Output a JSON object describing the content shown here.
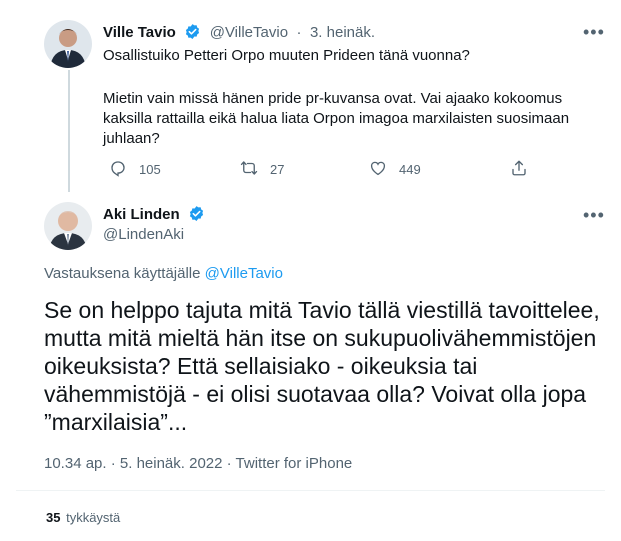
{
  "tweet1": {
    "author_name": "Ville Tavio",
    "handle": "@VilleTavio",
    "separator": "·",
    "date": "3. heinäk.",
    "text_p1": "Osallistuiko Petteri Orpo muuten Prideen tänä vuonna?",
    "text_p2": "Mietin vain missä hänen pride pr-kuvansa ovat. Vai ajaako kokoomus kaksilla rattailla eikä halua liata Orpon imagoa marxilaisten suosimaan juhlaan?",
    "replies": "105",
    "retweets": "27",
    "likes": "449"
  },
  "tweet2": {
    "author_name": "Aki Linden",
    "handle": "@LindenAki",
    "reply_prefix": "Vastauksena käyttäjälle",
    "reply_handle": "@VilleTavio",
    "text": "Se on helppo tajuta mitä Tavio tällä viestillä tavoittelee, mutta mitä mieltä hän itse on sukupuolivähemmistöjen oikeuksista? Että sellaisiako - oikeuksia tai vähemmistöjä - ei olisi suotavaa olla? Voivat olla jopa ”marxilaisia”...",
    "meta": "10.34 ap. · 5. heinäk. 2022 · Twitter for iPhone",
    "likes_count": "35",
    "likes_label": "tykkäystä"
  },
  "icons": {
    "more": "more-icon",
    "verified": "verified-icon",
    "reply": "reply-icon",
    "retweet": "retweet-icon",
    "like": "heart-icon",
    "share": "share-icon"
  },
  "colors": {
    "verified": "#1d9bf0",
    "link": "#1d9bf0",
    "muted": "#536471",
    "text": "#0f1419"
  }
}
